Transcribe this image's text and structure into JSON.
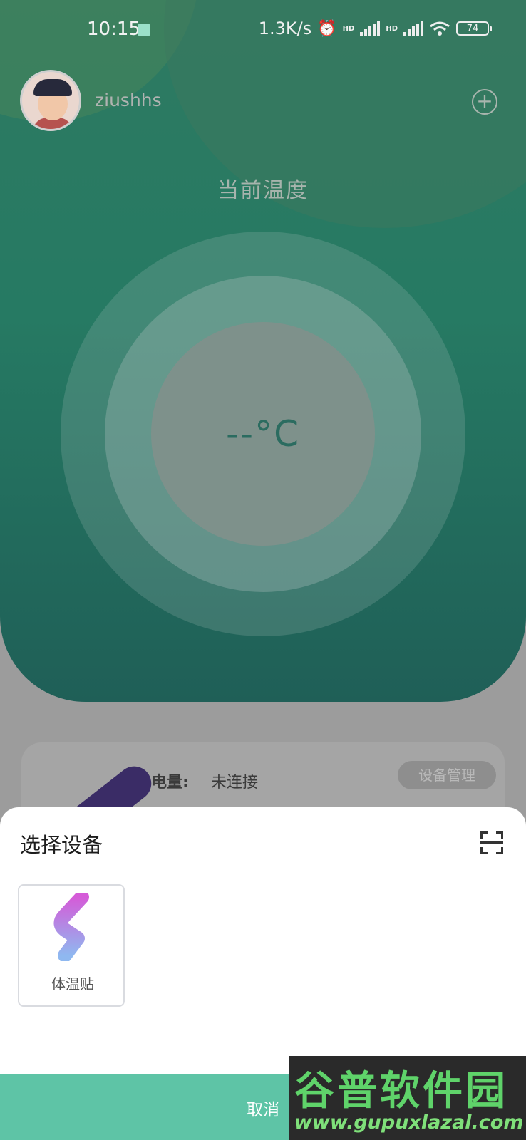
{
  "status_bar": {
    "time": "10:15",
    "network_speed": "1.3K/s",
    "signal1_label": "HD",
    "signal2_label": "HD",
    "battery": "74"
  },
  "header": {
    "username": "ziushhs",
    "add_icon": "plus-circle-icon"
  },
  "temperature": {
    "title": "当前温度",
    "value": "--°C"
  },
  "device_card": {
    "battery_label": "电量:",
    "battery_value": "未连接",
    "manage_label": "设备管理"
  },
  "sheet": {
    "title": "选择设备",
    "scan_icon": "scan-icon",
    "devices": [
      {
        "name": "体温贴",
        "icon": "patch-device-icon"
      }
    ],
    "cancel_label": "取消"
  },
  "watermark": {
    "title": "谷普软件园",
    "url": "www.gupuxlazal.com"
  },
  "colors": {
    "hero": "#2e7a62",
    "accent": "#5ec4a6",
    "temp_text": "#2b6c60"
  }
}
